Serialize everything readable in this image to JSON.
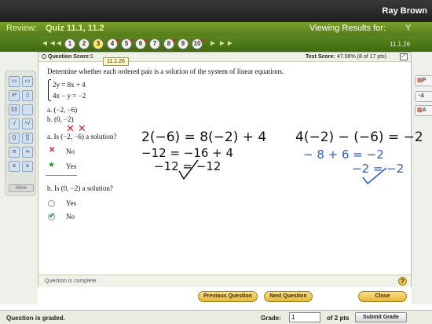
{
  "header": {
    "user": "Ray Brown"
  },
  "title_bar": {
    "review_label": "Review:",
    "quiz_title": "Quiz 11.1, 11.2",
    "viewing_label": "Viewing Results for:",
    "viewing_value": "Y"
  },
  "nav": {
    "first_arrow": "◄◄",
    "prev_arrow": "◄",
    "next_arrow": "►",
    "last_arrow": "►►",
    "questions": [
      "1",
      "2",
      "3",
      "4",
      "5",
      "6",
      "7",
      "8",
      "9",
      "10"
    ],
    "current_question": "3",
    "wrong_marker": "✕",
    "code": "11.1.26"
  },
  "score": {
    "question_score_label": "Question Score:",
    "question_score_value": "1",
    "tooltip": "11.1.26",
    "test_score_label": "Test Score:",
    "test_score_value": "47.06% (8 of 17 pts)",
    "expand_icon": "⤢"
  },
  "question": {
    "prompt": "Determine whether each ordered pair is a solution of the system of linear equations.",
    "eq1": "2y = 8x + 4",
    "eq2": "4x − y = −2",
    "pair_a": "a. (−2, −6)",
    "pair_b": "b. (0, −2)",
    "part_a": {
      "label": "a. Is (−2, −6) a solution?",
      "options": [
        "No",
        "Yes"
      ],
      "no_mark": "✕",
      "yes_mark": "★"
    },
    "part_b": {
      "label": "b. Is (0, −2) a solution?",
      "options": [
        "Yes",
        "No"
      ],
      "no_mark": "✔"
    },
    "complete_text": "Question is complete.",
    "help_icon": "?"
  },
  "handwriting": {
    "red_marks": "✕  ✕",
    "eq_a_line1": "2(−6) = 8(−2) + 4",
    "eq_a_line2": "−12 = −16 + 4",
    "eq_a_line3": "−12 = −12",
    "eq_b_line1": "4(−2) − (−6) = −2",
    "eq_b_line2": "− 8 + 6 = −2",
    "eq_b_line3": "−2 = −2"
  },
  "buttons": {
    "previous": "Previous Question",
    "next": "Next Question",
    "close": "Close"
  },
  "left_panel": {
    "more": "More"
  },
  "right_panel": {
    "btn1": "P",
    "btn2": "A",
    "btn3": "A"
  },
  "bottom": {
    "graded": "Question is graded.",
    "grade_label": "Grade:",
    "grade_value": "1",
    "of_pts": "of 2 pts",
    "submit": "Submit Grade"
  },
  "colors": {
    "green_bar": "#6b9424",
    "accent_gold": "#f0c24a",
    "ink_black": "#111111",
    "ink_blue": "#2a5bd6",
    "ink_red": "#d42020"
  }
}
